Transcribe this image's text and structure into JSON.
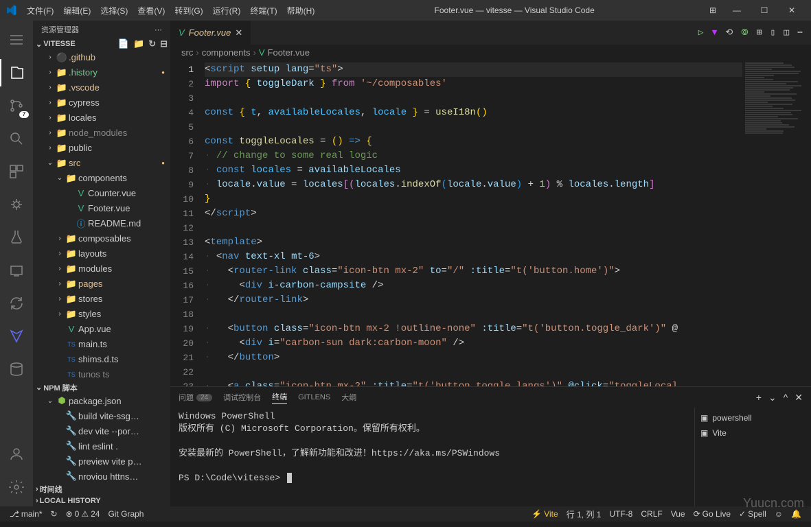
{
  "window": {
    "title": "Footer.vue — vitesse — Visual Studio Code"
  },
  "menu": {
    "file": "文件(F)",
    "edit": "编辑(E)",
    "select": "选择(S)",
    "view": "查看(V)",
    "goto": "转到(G)",
    "run": "运行(R)",
    "terminal": "终端(T)",
    "help": "帮助(H)"
  },
  "sidebar": {
    "title": "资源管理器",
    "project": "VITESSE",
    "tree": [
      {
        "name": ".github",
        "depth": 1,
        "type": "folder",
        "icon": "⚫",
        "open": false,
        "git": "mod"
      },
      {
        "name": ".history",
        "depth": 1,
        "type": "folder",
        "icon": "📁",
        "open": false,
        "git": "unt",
        "dot": true
      },
      {
        "name": ".vscode",
        "depth": 1,
        "type": "folder",
        "icon": "📁",
        "open": false,
        "git": "mod"
      },
      {
        "name": "cypress",
        "depth": 1,
        "type": "folder",
        "icon": "📁",
        "open": false
      },
      {
        "name": "locales",
        "depth": 1,
        "type": "folder",
        "icon": "📁",
        "open": false
      },
      {
        "name": "node_modules",
        "depth": 1,
        "type": "folder",
        "icon": "📁",
        "open": false,
        "dim": true
      },
      {
        "name": "public",
        "depth": 1,
        "type": "folder",
        "icon": "📁",
        "open": false
      },
      {
        "name": "src",
        "depth": 1,
        "type": "folder",
        "icon": "📁",
        "open": true,
        "git": "mod",
        "dot": true
      },
      {
        "name": "components",
        "depth": 2,
        "type": "folder",
        "icon": "📁",
        "open": true
      },
      {
        "name": "Counter.vue",
        "depth": 3,
        "type": "file",
        "icon": "V"
      },
      {
        "name": "Footer.vue",
        "depth": 3,
        "type": "file",
        "icon": "V"
      },
      {
        "name": "README.md",
        "depth": 3,
        "type": "file",
        "icon": "ⓘ"
      },
      {
        "name": "composables",
        "depth": 2,
        "type": "folder",
        "icon": "📁",
        "open": false
      },
      {
        "name": "layouts",
        "depth": 2,
        "type": "folder",
        "icon": "📁",
        "open": false
      },
      {
        "name": "modules",
        "depth": 2,
        "type": "folder",
        "icon": "📁",
        "open": false
      },
      {
        "name": "pages",
        "depth": 2,
        "type": "folder",
        "icon": "📁",
        "open": false,
        "git": "mod"
      },
      {
        "name": "stores",
        "depth": 2,
        "type": "folder",
        "icon": "📁",
        "open": false
      },
      {
        "name": "styles",
        "depth": 2,
        "type": "folder",
        "icon": "📁",
        "open": false
      },
      {
        "name": "App.vue",
        "depth": 2,
        "type": "file",
        "icon": "V"
      },
      {
        "name": "main.ts",
        "depth": 2,
        "type": "file",
        "icon": "TS"
      },
      {
        "name": "shims.d.ts",
        "depth": 2,
        "type": "file",
        "icon": "TS"
      },
      {
        "name": "tunos ts",
        "depth": 2,
        "type": "file",
        "icon": "TS",
        "dim": true
      }
    ],
    "npm_header": "NPM 脚本",
    "npm_scripts": [
      {
        "name": "package.json",
        "icon": "⬢"
      },
      {
        "name": "build vite-ssg…",
        "icon": "🔧"
      },
      {
        "name": "dev vite --por…",
        "icon": "🔧"
      },
      {
        "name": "lint eslint .",
        "icon": "🔧"
      },
      {
        "name": "preview vite p…",
        "icon": "🔧"
      },
      {
        "name": "nroviou httns…",
        "icon": "🔧"
      }
    ],
    "timeline": "时间线",
    "local_history": "LOCAL HISTORY"
  },
  "tab": {
    "name": "Footer.vue"
  },
  "breadcrumb": {
    "parts": [
      "src",
      "components",
      "Footer.vue"
    ]
  },
  "code": {
    "lines": [
      [
        [
          "<",
          "c-op"
        ],
        [
          "script",
          "c-tag"
        ],
        [
          " ",
          "c-op"
        ],
        [
          "setup",
          "c-attr"
        ],
        [
          " ",
          "c-op"
        ],
        [
          "lang",
          "c-attr"
        ],
        [
          "=",
          "c-op"
        ],
        [
          "\"ts\"",
          "c-str"
        ],
        [
          ">",
          "c-op"
        ]
      ],
      [
        [
          "import",
          "c-kw"
        ],
        [
          " ",
          "c-op"
        ],
        [
          "{",
          "c-brace"
        ],
        [
          " ",
          "c-op"
        ],
        [
          "toggleDark",
          "c-var"
        ],
        [
          " ",
          "c-op"
        ],
        [
          "}",
          "c-brace"
        ],
        [
          " ",
          "c-op"
        ],
        [
          "from",
          "c-kw"
        ],
        [
          " ",
          "c-op"
        ],
        [
          "'~/composables'",
          "c-str"
        ]
      ],
      [],
      [
        [
          "const",
          "c-tag"
        ],
        [
          " ",
          "c-op"
        ],
        [
          "{",
          "c-brace"
        ],
        [
          " ",
          "c-op"
        ],
        [
          "t",
          "c-const"
        ],
        [
          ", ",
          "c-op"
        ],
        [
          "availableLocales",
          "c-const"
        ],
        [
          ", ",
          "c-op"
        ],
        [
          "locale",
          "c-const"
        ],
        [
          " ",
          "c-op"
        ],
        [
          "}",
          "c-brace"
        ],
        [
          " = ",
          "c-op"
        ],
        [
          "useI18n",
          "c-fn"
        ],
        [
          "()",
          "c-brace"
        ]
      ],
      [],
      [
        [
          "const",
          "c-tag"
        ],
        [
          " ",
          "c-op"
        ],
        [
          "toggleLocales",
          "c-fn"
        ],
        [
          " = ",
          "c-op"
        ],
        [
          "()",
          "c-brace"
        ],
        [
          " ",
          "c-op"
        ],
        [
          "=>",
          "c-tag"
        ],
        [
          " ",
          "c-op"
        ],
        [
          "{",
          "c-brace"
        ]
      ],
      [
        [
          "·",
          "c-indent"
        ],
        [
          " ",
          "c-op"
        ],
        [
          "// change to some real logic",
          "c-cmt"
        ]
      ],
      [
        [
          "·",
          "c-indent"
        ],
        [
          " ",
          "c-op"
        ],
        [
          "const",
          "c-tag"
        ],
        [
          " ",
          "c-op"
        ],
        [
          "locales",
          "c-const"
        ],
        [
          " = ",
          "c-op"
        ],
        [
          "availableLocales",
          "c-var"
        ]
      ],
      [
        [
          "·",
          "c-indent"
        ],
        [
          " ",
          "c-op"
        ],
        [
          "locale",
          "c-var"
        ],
        [
          ".",
          "c-op"
        ],
        [
          "value",
          "c-var"
        ],
        [
          " = ",
          "c-op"
        ],
        [
          "locales",
          "c-var"
        ],
        [
          "[(",
          "c-br2"
        ],
        [
          "locales",
          "c-var"
        ],
        [
          ".",
          "c-op"
        ],
        [
          "indexOf",
          "c-fn"
        ],
        [
          "(",
          "c-br3"
        ],
        [
          "locale",
          "c-var"
        ],
        [
          ".",
          "c-op"
        ],
        [
          "value",
          "c-var"
        ],
        [
          ")",
          "c-br3"
        ],
        [
          " + ",
          "c-op"
        ],
        [
          "1",
          "c-num"
        ],
        [
          ")",
          "c-br2"
        ],
        [
          " % ",
          "c-op"
        ],
        [
          "locales",
          "c-var"
        ],
        [
          ".",
          "c-op"
        ],
        [
          "length",
          "c-var"
        ],
        [
          "]",
          "c-br2"
        ]
      ],
      [
        [
          "}",
          "c-brace"
        ]
      ],
      [
        [
          "</",
          "c-op"
        ],
        [
          "script",
          "c-tag"
        ],
        [
          ">",
          "c-op"
        ]
      ],
      [],
      [
        [
          "<",
          "c-op"
        ],
        [
          "template",
          "c-tag"
        ],
        [
          ">",
          "c-op"
        ]
      ],
      [
        [
          "·",
          "c-indent"
        ],
        [
          " ",
          "c-op"
        ],
        [
          "<",
          "c-op"
        ],
        [
          "nav",
          "c-tag"
        ],
        [
          " ",
          "c-op"
        ],
        [
          "text-xl",
          "c-attr"
        ],
        [
          " ",
          "c-op"
        ],
        [
          "mt-6",
          "c-attr"
        ],
        [
          ">",
          "c-op"
        ]
      ],
      [
        [
          "·",
          "c-indent"
        ],
        [
          "   ",
          "c-op"
        ],
        [
          "<",
          "c-op"
        ],
        [
          "router-link",
          "c-tag"
        ],
        [
          " ",
          "c-op"
        ],
        [
          "class",
          "c-attr"
        ],
        [
          "=",
          "c-op"
        ],
        [
          "\"icon-btn mx-2\"",
          "c-str"
        ],
        [
          " ",
          "c-op"
        ],
        [
          "to",
          "c-attr"
        ],
        [
          "=",
          "c-op"
        ],
        [
          "\"/\"",
          "c-str"
        ],
        [
          " ",
          "c-op"
        ],
        [
          ":title",
          "c-attr"
        ],
        [
          "=",
          "c-op"
        ],
        [
          "\"t('button.home')\"",
          "c-str"
        ],
        [
          ">",
          "c-op"
        ]
      ],
      [
        [
          "·",
          "c-indent"
        ],
        [
          "     ",
          "c-op"
        ],
        [
          "<",
          "c-op"
        ],
        [
          "div",
          "c-tag"
        ],
        [
          " ",
          "c-op"
        ],
        [
          "i-carbon-campsite",
          "c-attr"
        ],
        [
          " />",
          "c-op"
        ]
      ],
      [
        [
          "·",
          "c-indent"
        ],
        [
          "   ",
          "c-op"
        ],
        [
          "</",
          "c-op"
        ],
        [
          "router-link",
          "c-tag"
        ],
        [
          ">",
          "c-op"
        ]
      ],
      [],
      [
        [
          "·",
          "c-indent"
        ],
        [
          "   ",
          "c-op"
        ],
        [
          "<",
          "c-op"
        ],
        [
          "button",
          "c-tag"
        ],
        [
          " ",
          "c-op"
        ],
        [
          "class",
          "c-attr"
        ],
        [
          "=",
          "c-op"
        ],
        [
          "\"icon-btn mx-2 !outline-none\"",
          "c-str"
        ],
        [
          " ",
          "c-op"
        ],
        [
          ":title",
          "c-attr"
        ],
        [
          "=",
          "c-op"
        ],
        [
          "\"t('button.toggle_dark')\"",
          "c-str"
        ],
        [
          " @",
          "c-op"
        ]
      ],
      [
        [
          "·",
          "c-indent"
        ],
        [
          "     ",
          "c-op"
        ],
        [
          "<",
          "c-op"
        ],
        [
          "div",
          "c-tag"
        ],
        [
          " ",
          "c-op"
        ],
        [
          "i",
          "c-attr"
        ],
        [
          "=",
          "c-op"
        ],
        [
          "\"carbon-sun dark:carbon-moon\"",
          "c-str"
        ],
        [
          " />",
          "c-op"
        ]
      ],
      [
        [
          "·",
          "c-indent"
        ],
        [
          "   ",
          "c-op"
        ],
        [
          "</",
          "c-op"
        ],
        [
          "button",
          "c-tag"
        ],
        [
          ">",
          "c-op"
        ]
      ],
      [],
      [
        [
          "·",
          "c-indent"
        ],
        [
          "   ",
          "c-op"
        ],
        [
          "<",
          "c-op"
        ],
        [
          "a",
          "c-tag"
        ],
        [
          " ",
          "c-op"
        ],
        [
          "class",
          "c-attr"
        ],
        [
          "=",
          "c-op"
        ],
        [
          "\"icon-btn mx-2\"",
          "c-str"
        ],
        [
          " ",
          "c-op"
        ],
        [
          ":title",
          "c-attr"
        ],
        [
          "=",
          "c-op"
        ],
        [
          "\"t('button.toggle_langs')\"",
          "c-str"
        ],
        [
          " ",
          "c-op"
        ],
        [
          "@click",
          "c-attr"
        ],
        [
          "=",
          "c-op"
        ],
        [
          "\"toggleLocal",
          "c-str"
        ]
      ]
    ]
  },
  "panel": {
    "problems": "问题",
    "problems_count": "24",
    "debug_console": "调试控制台",
    "terminal": "终端",
    "gitlens": "GITLENS",
    "outline": "大纲",
    "term_sessions": [
      "powershell",
      "Vite"
    ],
    "term_lines": [
      "Windows PowerShell",
      "版权所有 (C)  Microsoft Corporation。保留所有权利。",
      "",
      "安装最新的 PowerShell，了解新功能和改进！https://aka.ms/PSWindows",
      ""
    ],
    "term_prompt": "PS D:\\Code\\vitesse> "
  },
  "status": {
    "branch": "main*",
    "sync": "↻",
    "errors": "0",
    "warnings": "24",
    "gitgraph": "Git Graph",
    "vite": "Vite",
    "position": "行 1, 列 1",
    "encoding": "UTF-8",
    "eol": "CRLF",
    "lang": "Vue",
    "golive": "Go Live",
    "spell": "Spell"
  },
  "activity_badge": "7",
  "watermark": "Yuucn.com"
}
